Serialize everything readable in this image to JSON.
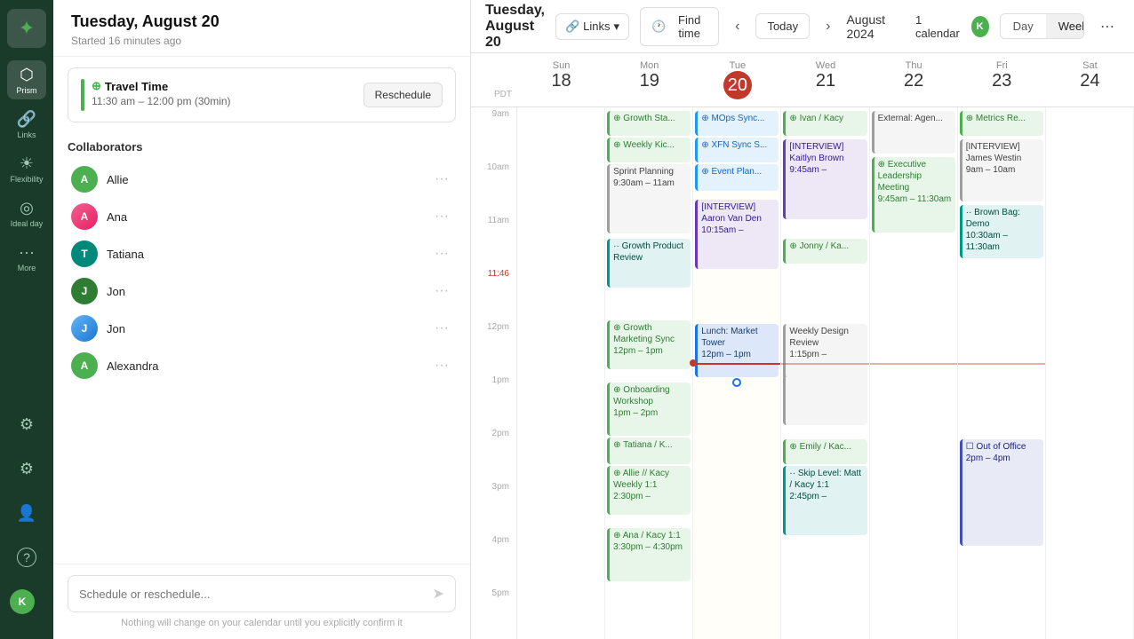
{
  "sidebar": {
    "logo_label": "K",
    "items": [
      {
        "id": "prism",
        "label": "Prism",
        "icon": "⬡",
        "active": true
      },
      {
        "id": "links",
        "label": "Links",
        "icon": "🔗"
      },
      {
        "id": "flexibility",
        "label": "Flexibility",
        "icon": "☀"
      },
      {
        "id": "ideal-day",
        "label": "Ideal day",
        "icon": "⚙"
      },
      {
        "id": "more",
        "label": "More",
        "icon": "⋯"
      }
    ],
    "bottom_items": [
      {
        "id": "settings1",
        "icon": "⚙",
        "label": ""
      },
      {
        "id": "settings2",
        "icon": "⚙",
        "label": ""
      },
      {
        "id": "user",
        "icon": "👤",
        "label": ""
      },
      {
        "id": "help",
        "icon": "?",
        "label": ""
      }
    ]
  },
  "panel": {
    "title": "Tuesday, August 20",
    "subtitle": "Started 16 minutes ago",
    "travel_card": {
      "title": "Travel Time",
      "time": "11:30 am – 12:00 pm (30min)",
      "reschedule_label": "Reschedule"
    },
    "collaborators_title": "Collaborators",
    "collaborators": [
      {
        "name": "Allie",
        "initial": "A",
        "color": "green"
      },
      {
        "name": "Ana",
        "initial": "A",
        "color": "blue",
        "has_photo": true
      },
      {
        "name": "Tatiana",
        "initial": "T",
        "color": "teal"
      },
      {
        "name": "Jon",
        "initial": "J",
        "color": "dark-green"
      },
      {
        "name": "Jon",
        "initial": "J",
        "color": "blue",
        "has_photo": true
      },
      {
        "name": "Alexandra",
        "initial": "A",
        "color": "green"
      }
    ],
    "chat_placeholder": "Schedule or reschedule...",
    "chat_hint": "Nothing will change on your calendar until you explicitly confirm it"
  },
  "topbar": {
    "date": "Tuesday, August 20",
    "links_label": "Links",
    "find_time_label": "Find time",
    "today_label": "Today",
    "month_label": "August 2024",
    "calendar_count": "1 calendar",
    "day_view_label": "Day",
    "week_view_label": "Week"
  },
  "calendar": {
    "days": [
      {
        "name": "Sun",
        "num": "18",
        "today": false
      },
      {
        "name": "Mon",
        "num": "19",
        "today": false
      },
      {
        "name": "Tue",
        "num": "20",
        "today": true
      },
      {
        "name": "Wed",
        "num": "21",
        "today": false
      },
      {
        "name": "Thu",
        "num": "22",
        "today": false
      },
      {
        "name": "Fri",
        "num": "23",
        "today": false
      },
      {
        "name": "Sat",
        "num": "24",
        "today": false
      }
    ],
    "times": [
      "9am",
      "10am",
      "11am",
      "11:46",
      "12pm",
      "1pm",
      "2pm",
      "3pm",
      "4pm",
      "5pm"
    ],
    "pdt_label": "PDT"
  }
}
